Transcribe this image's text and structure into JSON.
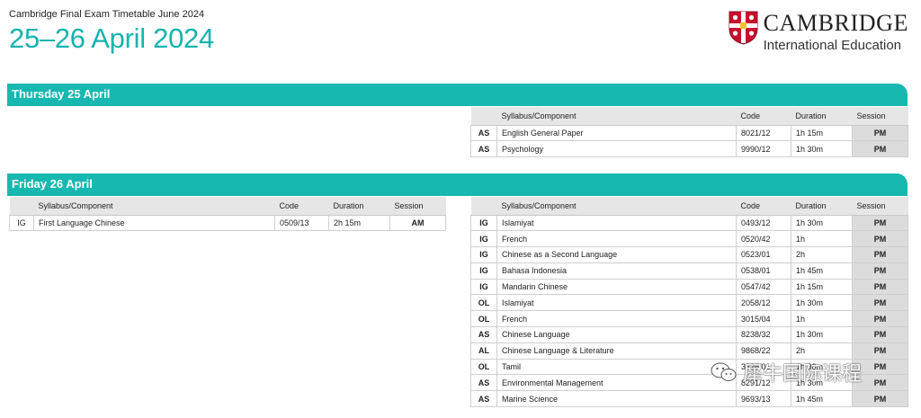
{
  "header": {
    "subtitle": "Cambridge Final Exam Timetable June 2024",
    "title": "25–26 April 2024"
  },
  "logo": {
    "name": "CAMBRIDGE",
    "subtitle": "International Education"
  },
  "columns": {
    "syllabus": "Syllabus/Component",
    "code": "Code",
    "duration": "Duration",
    "session": "Session"
  },
  "days": [
    {
      "label": "Thursday 25 April",
      "left_table": [],
      "right_table": [
        {
          "level": "AS",
          "syllabus": "English General Paper",
          "code": "8021/12",
          "duration": "1h 15m",
          "session": "PM"
        },
        {
          "level": "AS",
          "syllabus": "Psychology",
          "code": "9990/12",
          "duration": "1h 30m",
          "session": "PM"
        }
      ]
    },
    {
      "label": "Friday 26 April",
      "left_table": [
        {
          "level": "IG",
          "syllabus": "First Language Chinese",
          "code": "0509/13",
          "duration": "2h 15m",
          "session": "AM"
        }
      ],
      "right_table": [
        {
          "level": "IG",
          "syllabus": "Islamiyat",
          "code": "0493/12",
          "duration": "1h 30m",
          "session": "PM"
        },
        {
          "level": "IG",
          "syllabus": "French",
          "code": "0520/42",
          "duration": "1h",
          "session": "PM"
        },
        {
          "level": "IG",
          "syllabus": "Chinese as a Second Language",
          "code": "0523/01",
          "duration": "2h",
          "session": "PM"
        },
        {
          "level": "IG",
          "syllabus": "Bahasa Indonesia",
          "code": "0538/01",
          "duration": "1h 45m",
          "session": "PM"
        },
        {
          "level": "IG",
          "syllabus": "Mandarin Chinese",
          "code": "0547/42",
          "duration": "1h 15m",
          "session": "PM"
        },
        {
          "level": "OL",
          "syllabus": "Islamiyat",
          "code": "2058/12",
          "duration": "1h 30m",
          "session": "PM"
        },
        {
          "level": "OL",
          "syllabus": "French",
          "code": "3015/04",
          "duration": "1h",
          "session": "PM"
        },
        {
          "level": "AS",
          "syllabus": "Chinese Language",
          "code": "8238/32",
          "duration": "1h 30m",
          "session": "PM"
        },
        {
          "level": "AL",
          "syllabus": "Chinese Language & Literature",
          "code": "9868/22",
          "duration": "2h",
          "session": "PM"
        },
        {
          "level": "OL",
          "syllabus": "Tamil",
          "code": "3226/01",
          "duration": "1h 30m",
          "session": "PM"
        },
        {
          "level": "AS",
          "syllabus": "Environmental Management",
          "code": "8291/12",
          "duration": "1h 30m",
          "session": "PM"
        },
        {
          "level": "AS",
          "syllabus": "Marine Science",
          "code": "9693/13",
          "duration": "1h 45m",
          "session": "PM"
        }
      ]
    }
  ],
  "watermark": {
    "text": "犀牛国际课程"
  },
  "colors": {
    "teal": "#17b8b0",
    "header_grey": "#e6e6e6",
    "pm_grey": "#dcdcdc",
    "crest_red": "#c8102e"
  }
}
